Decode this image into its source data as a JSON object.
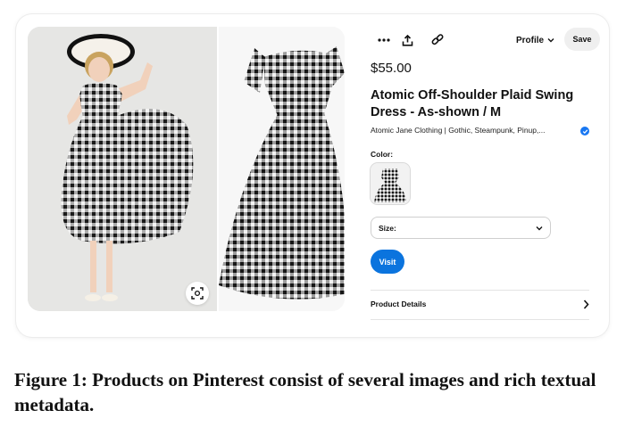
{
  "toolbar": {
    "icons": [
      "more-icon",
      "share-icon",
      "link-icon"
    ],
    "profile_label": "Profile",
    "save_label": "Save"
  },
  "product": {
    "price": "$55.00",
    "title": "Atomic Off-Shoulder Plaid Swing Dress - As-shown / M",
    "merchant": "Atomic Jane Clothing | Gothic, Steampunk, Pinup,...",
    "color_label": "Color:",
    "size_label": "Size:",
    "visit_label": "Visit",
    "details_label": "Product Details"
  },
  "caption": "Figure 1: Products on Pinterest consist of several images and rich textual metadata."
}
